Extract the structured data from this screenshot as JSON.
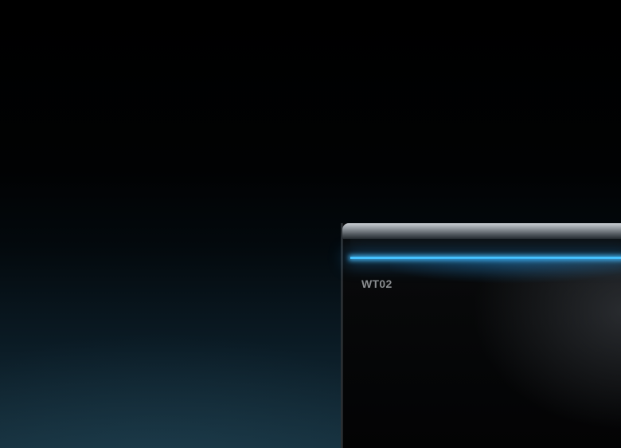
{
  "device": {
    "model_label": "WT02",
    "light_color": "#46c3ff"
  }
}
